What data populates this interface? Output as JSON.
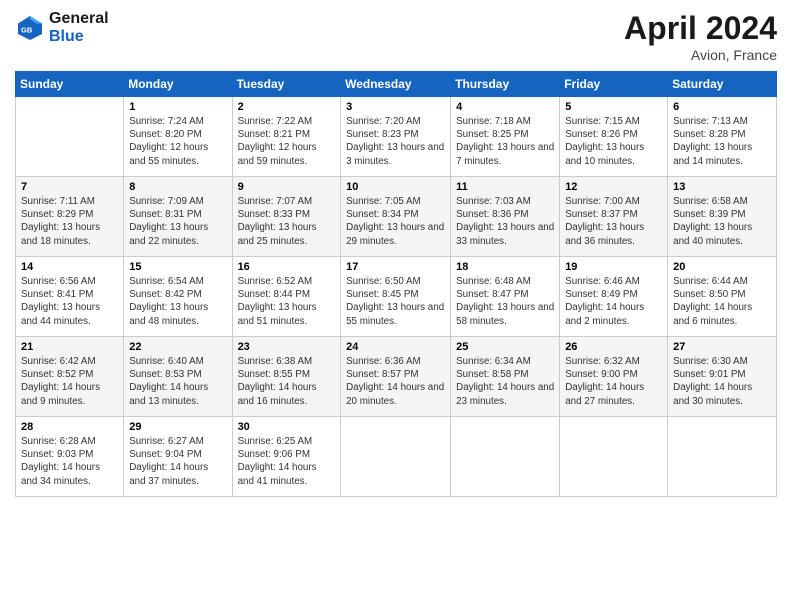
{
  "header": {
    "logo_line1": "General",
    "logo_line2": "Blue",
    "month_title": "April 2024",
    "location": "Avion, France"
  },
  "weekdays": [
    "Sunday",
    "Monday",
    "Tuesday",
    "Wednesday",
    "Thursday",
    "Friday",
    "Saturday"
  ],
  "weeks": [
    [
      {
        "day": "",
        "sunrise": "",
        "sunset": "",
        "daylight": ""
      },
      {
        "day": "1",
        "sunrise": "Sunrise: 7:24 AM",
        "sunset": "Sunset: 8:20 PM",
        "daylight": "Daylight: 12 hours and 55 minutes."
      },
      {
        "day": "2",
        "sunrise": "Sunrise: 7:22 AM",
        "sunset": "Sunset: 8:21 PM",
        "daylight": "Daylight: 12 hours and 59 minutes."
      },
      {
        "day": "3",
        "sunrise": "Sunrise: 7:20 AM",
        "sunset": "Sunset: 8:23 PM",
        "daylight": "Daylight: 13 hours and 3 minutes."
      },
      {
        "day": "4",
        "sunrise": "Sunrise: 7:18 AM",
        "sunset": "Sunset: 8:25 PM",
        "daylight": "Daylight: 13 hours and 7 minutes."
      },
      {
        "day": "5",
        "sunrise": "Sunrise: 7:15 AM",
        "sunset": "Sunset: 8:26 PM",
        "daylight": "Daylight: 13 hours and 10 minutes."
      },
      {
        "day": "6",
        "sunrise": "Sunrise: 7:13 AM",
        "sunset": "Sunset: 8:28 PM",
        "daylight": "Daylight: 13 hours and 14 minutes."
      }
    ],
    [
      {
        "day": "7",
        "sunrise": "Sunrise: 7:11 AM",
        "sunset": "Sunset: 8:29 PM",
        "daylight": "Daylight: 13 hours and 18 minutes."
      },
      {
        "day": "8",
        "sunrise": "Sunrise: 7:09 AM",
        "sunset": "Sunset: 8:31 PM",
        "daylight": "Daylight: 13 hours and 22 minutes."
      },
      {
        "day": "9",
        "sunrise": "Sunrise: 7:07 AM",
        "sunset": "Sunset: 8:33 PM",
        "daylight": "Daylight: 13 hours and 25 minutes."
      },
      {
        "day": "10",
        "sunrise": "Sunrise: 7:05 AM",
        "sunset": "Sunset: 8:34 PM",
        "daylight": "Daylight: 13 hours and 29 minutes."
      },
      {
        "day": "11",
        "sunrise": "Sunrise: 7:03 AM",
        "sunset": "Sunset: 8:36 PM",
        "daylight": "Daylight: 13 hours and 33 minutes."
      },
      {
        "day": "12",
        "sunrise": "Sunrise: 7:00 AM",
        "sunset": "Sunset: 8:37 PM",
        "daylight": "Daylight: 13 hours and 36 minutes."
      },
      {
        "day": "13",
        "sunrise": "Sunrise: 6:58 AM",
        "sunset": "Sunset: 8:39 PM",
        "daylight": "Daylight: 13 hours and 40 minutes."
      }
    ],
    [
      {
        "day": "14",
        "sunrise": "Sunrise: 6:56 AM",
        "sunset": "Sunset: 8:41 PM",
        "daylight": "Daylight: 13 hours and 44 minutes."
      },
      {
        "day": "15",
        "sunrise": "Sunrise: 6:54 AM",
        "sunset": "Sunset: 8:42 PM",
        "daylight": "Daylight: 13 hours and 48 minutes."
      },
      {
        "day": "16",
        "sunrise": "Sunrise: 6:52 AM",
        "sunset": "Sunset: 8:44 PM",
        "daylight": "Daylight: 13 hours and 51 minutes."
      },
      {
        "day": "17",
        "sunrise": "Sunrise: 6:50 AM",
        "sunset": "Sunset: 8:45 PM",
        "daylight": "Daylight: 13 hours and 55 minutes."
      },
      {
        "day": "18",
        "sunrise": "Sunrise: 6:48 AM",
        "sunset": "Sunset: 8:47 PM",
        "daylight": "Daylight: 13 hours and 58 minutes."
      },
      {
        "day": "19",
        "sunrise": "Sunrise: 6:46 AM",
        "sunset": "Sunset: 8:49 PM",
        "daylight": "Daylight: 14 hours and 2 minutes."
      },
      {
        "day": "20",
        "sunrise": "Sunrise: 6:44 AM",
        "sunset": "Sunset: 8:50 PM",
        "daylight": "Daylight: 14 hours and 6 minutes."
      }
    ],
    [
      {
        "day": "21",
        "sunrise": "Sunrise: 6:42 AM",
        "sunset": "Sunset: 8:52 PM",
        "daylight": "Daylight: 14 hours and 9 minutes."
      },
      {
        "day": "22",
        "sunrise": "Sunrise: 6:40 AM",
        "sunset": "Sunset: 8:53 PM",
        "daylight": "Daylight: 14 hours and 13 minutes."
      },
      {
        "day": "23",
        "sunrise": "Sunrise: 6:38 AM",
        "sunset": "Sunset: 8:55 PM",
        "daylight": "Daylight: 14 hours and 16 minutes."
      },
      {
        "day": "24",
        "sunrise": "Sunrise: 6:36 AM",
        "sunset": "Sunset: 8:57 PM",
        "daylight": "Daylight: 14 hours and 20 minutes."
      },
      {
        "day": "25",
        "sunrise": "Sunrise: 6:34 AM",
        "sunset": "Sunset: 8:58 PM",
        "daylight": "Daylight: 14 hours and 23 minutes."
      },
      {
        "day": "26",
        "sunrise": "Sunrise: 6:32 AM",
        "sunset": "Sunset: 9:00 PM",
        "daylight": "Daylight: 14 hours and 27 minutes."
      },
      {
        "day": "27",
        "sunrise": "Sunrise: 6:30 AM",
        "sunset": "Sunset: 9:01 PM",
        "daylight": "Daylight: 14 hours and 30 minutes."
      }
    ],
    [
      {
        "day": "28",
        "sunrise": "Sunrise: 6:28 AM",
        "sunset": "Sunset: 9:03 PM",
        "daylight": "Daylight: 14 hours and 34 minutes."
      },
      {
        "day": "29",
        "sunrise": "Sunrise: 6:27 AM",
        "sunset": "Sunset: 9:04 PM",
        "daylight": "Daylight: 14 hours and 37 minutes."
      },
      {
        "day": "30",
        "sunrise": "Sunrise: 6:25 AM",
        "sunset": "Sunset: 9:06 PM",
        "daylight": "Daylight: 14 hours and 41 minutes."
      },
      {
        "day": "",
        "sunrise": "",
        "sunset": "",
        "daylight": ""
      },
      {
        "day": "",
        "sunrise": "",
        "sunset": "",
        "daylight": ""
      },
      {
        "day": "",
        "sunrise": "",
        "sunset": "",
        "daylight": ""
      },
      {
        "day": "",
        "sunrise": "",
        "sunset": "",
        "daylight": ""
      }
    ]
  ]
}
